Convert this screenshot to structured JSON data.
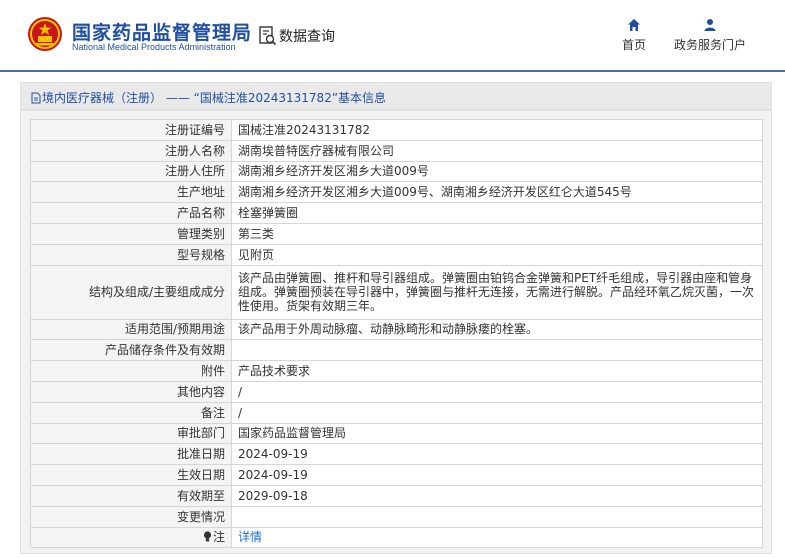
{
  "header": {
    "site_title": "国家药品监督管理局",
    "site_subtitle": "National Medical Products Administration",
    "query_label": "数据查询",
    "nav": {
      "home": "首页",
      "portal": "政务服务门户"
    }
  },
  "breadcrumb": {
    "text": "境内医疗器械（注册） —— “国械注准20243131782”基本信息"
  },
  "rows": [
    {
      "label": "注册证编号",
      "value": "国械注准20243131782"
    },
    {
      "label": "注册人名称",
      "value": "湖南埃普特医疗器械有限公司"
    },
    {
      "label": "注册人住所",
      "value": "湖南湘乡经济开发区湘乡大道009号"
    },
    {
      "label": "生产地址",
      "value": "湖南湘乡经济开发区湘乡大道009号、湖南湘乡经济开发区红仑大道545号"
    },
    {
      "label": "产品名称",
      "value": "栓塞弹簧圈"
    },
    {
      "label": "管理类别",
      "value": "第三类"
    },
    {
      "label": "型号规格",
      "value": "见附页"
    },
    {
      "label": "结构及组成/主要组成成分",
      "value": "该产品由弹簧圈、推杆和导引器组成。弹簧圈由铂钨合金弹簧和PET纤毛组成，导引器由座和管身组成。弹簧圈预装在导引器中，弹簧圈与推杆无连接，无需进行解脱。产品经环氧乙烷灭菌，一次性使用。货架有效期三年。"
    },
    {
      "label": "适用范围/预期用途",
      "value": "该产品用于外周动脉瘤、动静脉畸形和动静脉瘘的栓塞。"
    },
    {
      "label": "产品储存条件及有效期",
      "value": ""
    },
    {
      "label": "附件",
      "value": "产品技术要求"
    },
    {
      "label": "其他内容",
      "value": "/"
    },
    {
      "label": "备注",
      "value": "/"
    },
    {
      "label": "审批部门",
      "value": "国家药品监督管理局"
    },
    {
      "label": "批准日期",
      "value": "2024-09-19"
    },
    {
      "label": "生效日期",
      "value": "2024-09-19"
    },
    {
      "label": "有效期至",
      "value": "2029-09-18"
    },
    {
      "label": "变更情况",
      "value": ""
    }
  ],
  "note_row": {
    "label": "注",
    "link_text": "详情"
  },
  "colors": {
    "brand_blue": "#1f4f9e",
    "link_blue": "#1f6fd1",
    "emblem_red": "#c8161d",
    "emblem_gold": "#f2c200"
  }
}
